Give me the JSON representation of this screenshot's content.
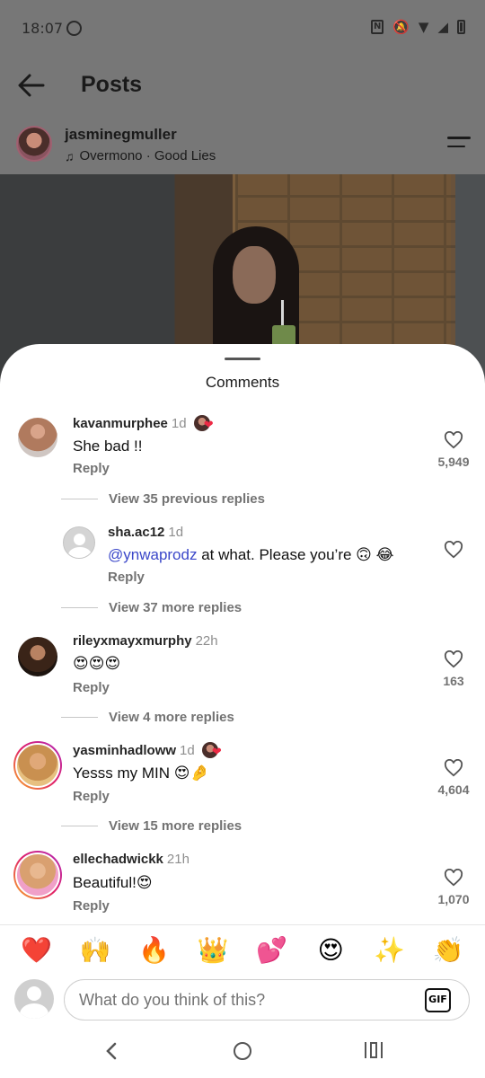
{
  "status_bar": {
    "time": "18:07"
  },
  "header": {
    "title": "Posts"
  },
  "post": {
    "username": "jasminegmuller",
    "music": "Overmono · Good Lies"
  },
  "sheet": {
    "title": "Comments"
  },
  "comments": [
    {
      "user": "kavanmurphee",
      "time": "1d",
      "text": "She bad !!",
      "reply": "Reply",
      "likes": "5,949",
      "creator_liked": true
    },
    {
      "view_more": "View 35 previous replies"
    },
    {
      "user": "sha.ac12",
      "time": "1d",
      "mention": "@ynwaprodz",
      "text": " at what. Please you’re 🙃 😂",
      "reply": "Reply"
    },
    {
      "view_more": "View 37 more replies"
    },
    {
      "user": "rileyxmayxmurphy",
      "time": "22h",
      "text": "😍😍😍",
      "reply": "Reply",
      "likes": "163"
    },
    {
      "view_more": "View 4 more replies"
    },
    {
      "user": "yasminhadloww",
      "time": "1d",
      "text": "Yesss my MIN 😍🤌",
      "reply": "Reply",
      "likes": "4,604",
      "creator_liked": true
    },
    {
      "view_more": "View 15 more replies"
    },
    {
      "user": "ellechadwickk",
      "time": "21h",
      "text": "Beautiful!😍",
      "reply": "Reply",
      "likes": "1,070"
    }
  ],
  "emoji_bar": [
    "❤️",
    "🙌",
    "🔥",
    "👑",
    "💕",
    "😍",
    "✨",
    "👏"
  ],
  "input": {
    "placeholder": "What do you think of this?",
    "gif_label": "GIF"
  },
  "icons": {
    "back": "arrow-left-icon",
    "options": "options-icon",
    "music": "music-note-icon",
    "like": "heart-outline-icon"
  }
}
